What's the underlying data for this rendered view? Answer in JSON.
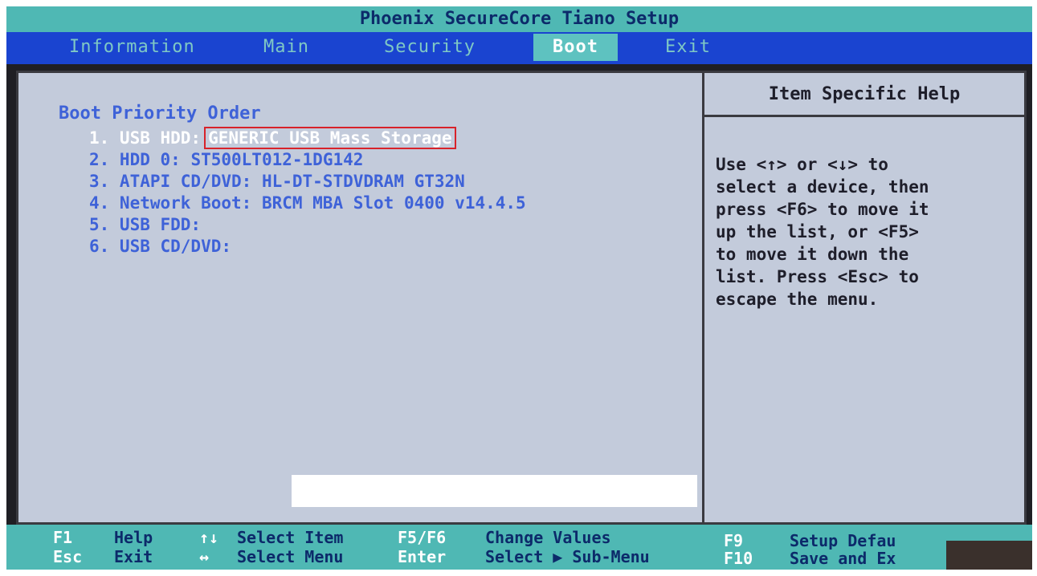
{
  "title": "Phoenix SecureCore Tiano Setup",
  "menu": {
    "tabs": [
      {
        "label": "Information"
      },
      {
        "label": "Main"
      },
      {
        "label": "Security"
      },
      {
        "label": "Boot",
        "active": true
      },
      {
        "label": "Exit"
      }
    ]
  },
  "boot": {
    "section_title": "Boot Priority Order",
    "items": [
      {
        "label": "1. USB HDD:",
        "value": "GENERIC USB Mass Storage",
        "selected": true
      },
      {
        "label": "2. HDD 0:",
        "value": "ST500LT012-1DG142"
      },
      {
        "label": "3. ATAPI CD/DVD:",
        "value": "HL-DT-STDVDRAM GT32N"
      },
      {
        "label": "4. Network Boot:",
        "value": "BRCM MBA Slot 0400 v14.4.5"
      },
      {
        "label": "5. USB FDD:",
        "value": ""
      },
      {
        "label": "6. USB CD/DVD:",
        "value": ""
      }
    ]
  },
  "help": {
    "title": "Item Specific Help",
    "text": "Use <↑> or <↓> to\nselect a device, then\npress <F6> to move it\nup the list, or <F5>\nto move it down the\nlist. Press <Esc> to\nescape the menu."
  },
  "statusbar": {
    "keys": [
      {
        "key": "F1",
        "desc": "Help"
      },
      {
        "key": "Esc",
        "desc": "Exit"
      },
      {
        "key": "↑↓",
        "desc": "Select Item"
      },
      {
        "key": "↔",
        "desc": "Select Menu"
      },
      {
        "key": "F5/F6",
        "desc": "Change Values"
      },
      {
        "key": "Enter",
        "desc": "Select ▶ Sub-Menu"
      },
      {
        "key": "F9",
        "desc": "Setup Defau"
      },
      {
        "key": "F10",
        "desc": "Save and Ex"
      }
    ]
  },
  "colors": {
    "title_bar": "#4fb8b4",
    "menu_bar": "#1a44d0",
    "panel_bg": "#c3cbdb",
    "item_text": "#3e62d8",
    "selection_box": "#d8222a"
  }
}
